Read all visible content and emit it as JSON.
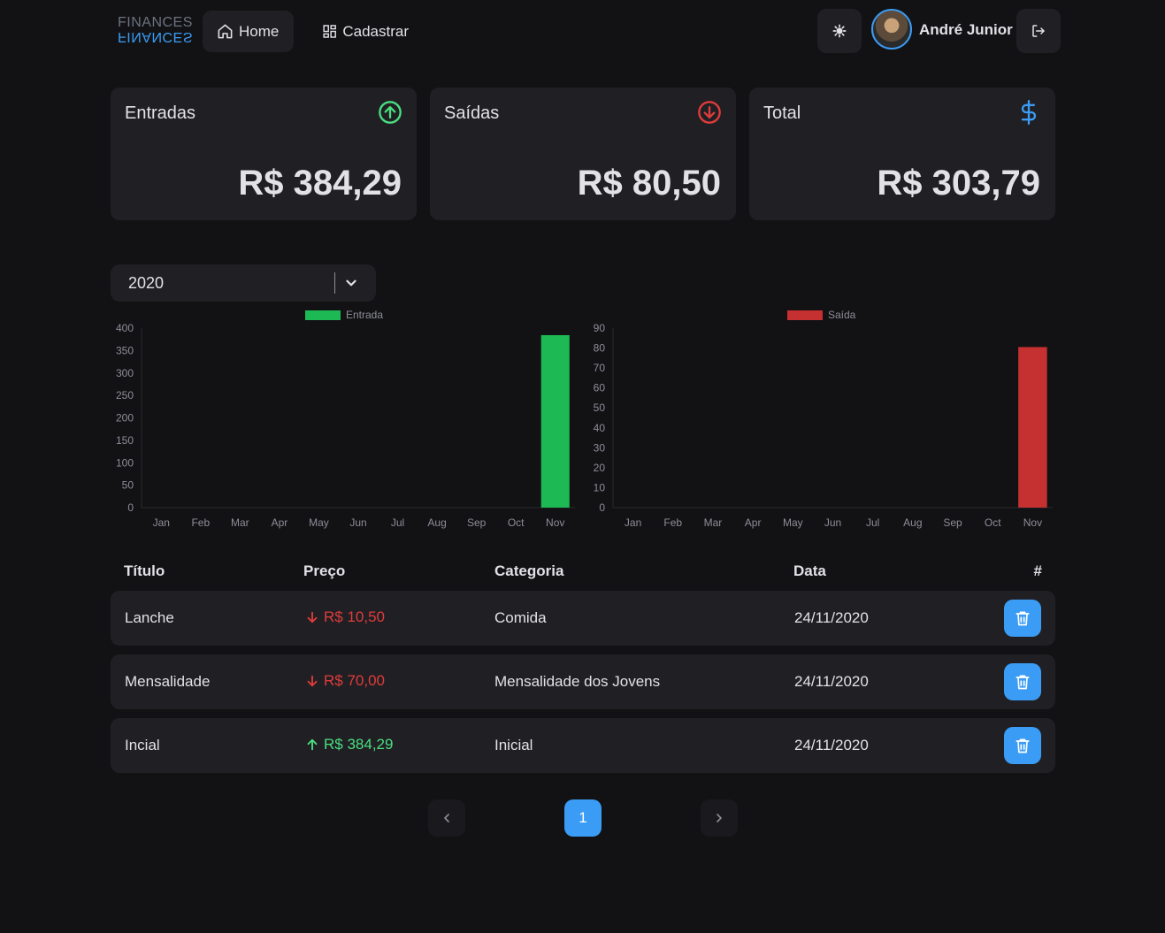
{
  "header": {
    "logo_text": "FINANCES",
    "nav": {
      "home": "Home",
      "register": "Cadastrar"
    },
    "user_name": "André Junior"
  },
  "summary": {
    "income": {
      "label": "Entradas",
      "value": "R$ 384,29",
      "color": "#4ade80"
    },
    "outcome": {
      "label": "Saídas",
      "value": "R$ 80,50",
      "color": "#e03b3b"
    },
    "total": {
      "label": "Total",
      "value": "R$ 303,79",
      "color": "#3b9cf5"
    }
  },
  "filter": {
    "year": "2020"
  },
  "chart_data": [
    {
      "type": "bar",
      "categories": [
        "Jan",
        "Feb",
        "Mar",
        "Apr",
        "May",
        "Jun",
        "Jul",
        "Aug",
        "Sep",
        "Oct",
        "Nov"
      ],
      "series": [
        {
          "name": "Entrada",
          "values": [
            0,
            0,
            0,
            0,
            0,
            0,
            0,
            0,
            0,
            0,
            384.29
          ],
          "color": "#1db954"
        }
      ],
      "ylim": [
        0,
        400
      ],
      "yticks": [
        0,
        50,
        100,
        150,
        200,
        250,
        300,
        350,
        400
      ],
      "legend": "top"
    },
    {
      "type": "bar",
      "categories": [
        "Jan",
        "Feb",
        "Mar",
        "Apr",
        "May",
        "Jun",
        "Jul",
        "Aug",
        "Sep",
        "Oct",
        "Nov"
      ],
      "series": [
        {
          "name": "Saída",
          "values": [
            0,
            0,
            0,
            0,
            0,
            0,
            0,
            0,
            0,
            0,
            80.5
          ],
          "color": "#c53030"
        }
      ],
      "ylim": [
        0,
        90
      ],
      "yticks": [
        0,
        10,
        20,
        30,
        40,
        50,
        60,
        70,
        80,
        90
      ],
      "legend": "top"
    }
  ],
  "table": {
    "headers": {
      "title": "Título",
      "price": "Preço",
      "category": "Categoria",
      "date": "Data",
      "actions": "#"
    },
    "rows": [
      {
        "title": "Lanche",
        "price": "R$ 10,50",
        "type": "out",
        "category": "Comida",
        "date": "24/11/2020"
      },
      {
        "title": "Mensalidade",
        "price": "R$ 70,00",
        "type": "out",
        "category": "Mensalidade dos Jovens",
        "date": "24/11/2020"
      },
      {
        "title": "Incial",
        "price": "R$ 384,29",
        "type": "in",
        "category": "Inicial",
        "date": "24/11/2020"
      }
    ]
  },
  "pagination": {
    "current": "1"
  }
}
